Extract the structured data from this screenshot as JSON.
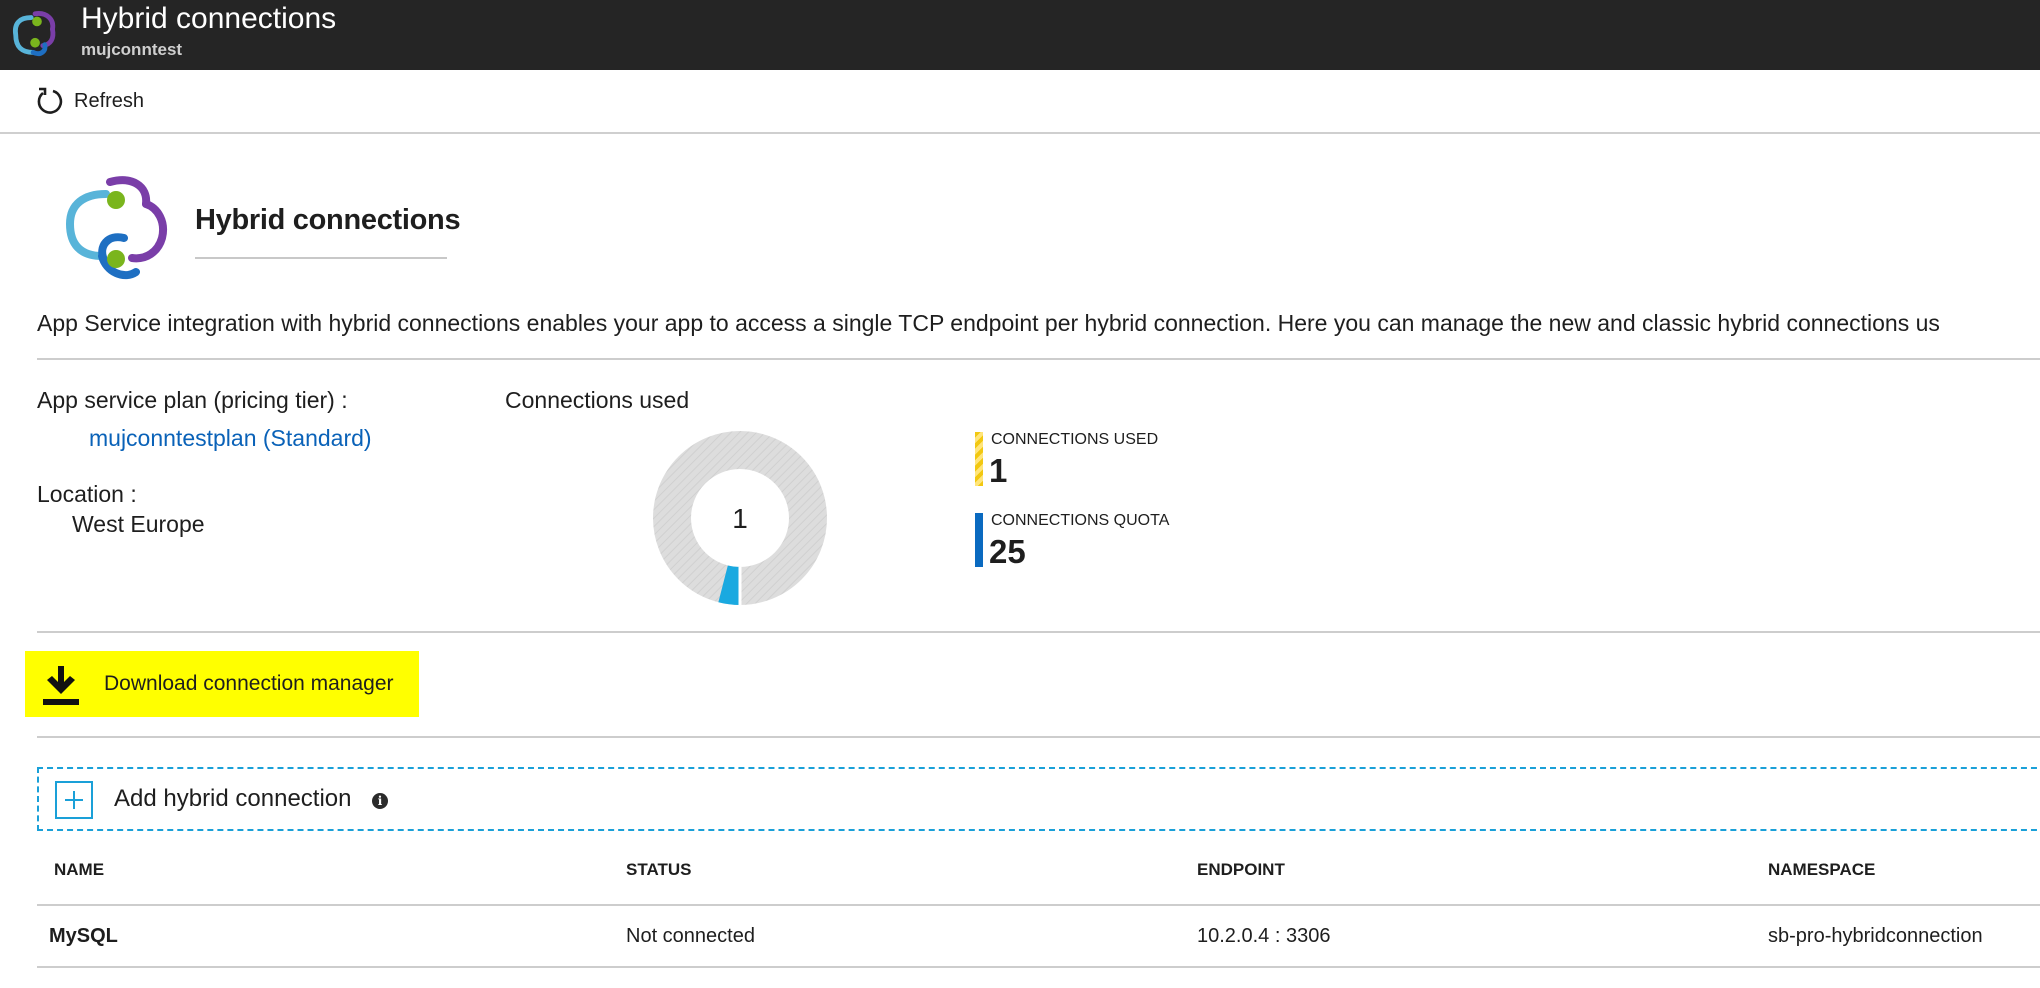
{
  "header": {
    "title": "Hybrid connections",
    "subtitle": "mujconntest"
  },
  "toolbar": {
    "refresh_label": "Refresh"
  },
  "hero": {
    "title": "Hybrid connections",
    "description": "App Service integration with hybrid connections enables your app to access a single TCP endpoint per hybrid connection. Here you can manage the new and classic hybrid connections us"
  },
  "plan": {
    "label": "App service plan (pricing tier) :",
    "value": "mujconntestplan (Standard)"
  },
  "location": {
    "label": "Location :",
    "value": "West Europe"
  },
  "connections_chart": {
    "title": "Connections used",
    "center_value": "1",
    "used": 1,
    "quota": 25,
    "legend": [
      {
        "label": "CONNECTIONS USED",
        "value": "1",
        "color": "#f2c811"
      },
      {
        "label": "CONNECTIONS QUOTA",
        "value": "25",
        "color": "#0a6ac0"
      }
    ],
    "colors": {
      "track": "#dddddd",
      "used_segment": "#1aa9e0"
    }
  },
  "download": {
    "label": "Download connection manager",
    "highlight_color": "#ffff00"
  },
  "add_connection": {
    "label": "Add hybrid connection"
  },
  "table": {
    "columns": [
      "NAME",
      "STATUS",
      "ENDPOINT",
      "NAMESPACE"
    ],
    "rows": [
      [
        "MySQL",
        "Not connected",
        "10.2.0.4 : 3306",
        "sb-pro-hybridconnection"
      ]
    ]
  },
  "icons": {
    "refresh": "refresh-icon",
    "download": "download-icon",
    "add": "plus-icon",
    "info": "info-icon",
    "logo": "hybrid-connections-logo"
  }
}
